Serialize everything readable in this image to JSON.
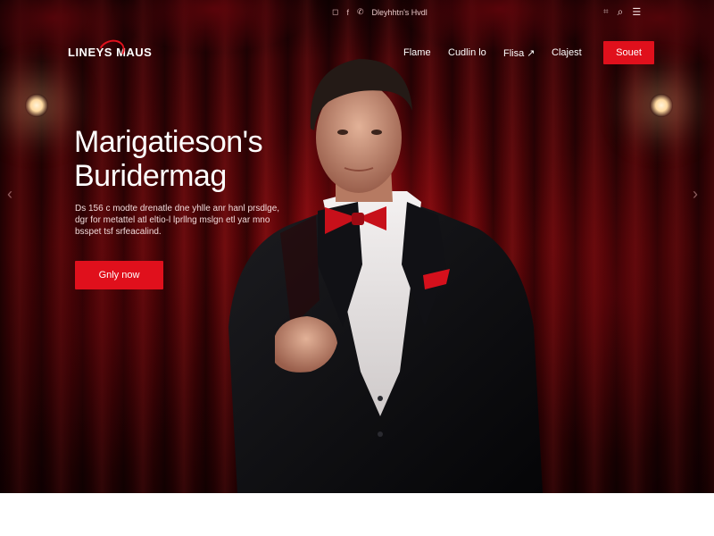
{
  "topbar": {
    "icons": [
      "instagram-icon",
      "facebook-icon",
      "phone-icon"
    ],
    "contact_text": "Dleyhhtn's Hvdl",
    "right_icons": [
      "cart-icon",
      "search-icon",
      "menu-icon"
    ]
  },
  "logo": {
    "text": "LINEYS MAUS"
  },
  "nav": {
    "items": [
      {
        "label": "Flame"
      },
      {
        "label": "Cudlin lo"
      },
      {
        "label": "Flisa ↗"
      },
      {
        "label": "Clajest"
      }
    ],
    "cta_label": "Souet"
  },
  "hero": {
    "headline_line1": "Marigatieson's",
    "headline_line2": "Buridermag",
    "description": "Ds 156 c modte drenatle dne yhlle anr hanl prsdlge, dgr for metattel atl eltio-l lprllng mslgn etl yar mno bsspet tsf srfeacalind.",
    "cta_label": "Gnly now"
  },
  "colors": {
    "accent": "#e0101c",
    "curtain": "#6e0609",
    "dark": "#2a0204"
  }
}
